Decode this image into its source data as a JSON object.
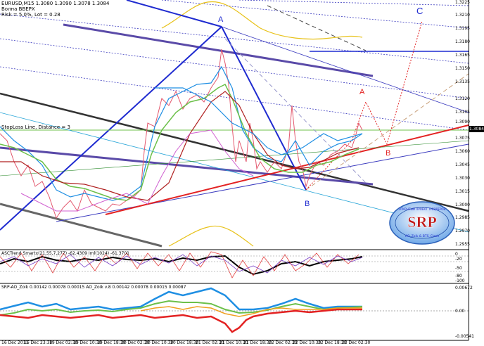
{
  "header": {
    "symbol_line": "EURUSD,M15  1.3080 1.3090 1.3078 1.3084",
    "indicator_name": "Волна BBEPX",
    "risk_line": "Risk = 5.0%, Lot = 0.28",
    "stoploss_label": "StopLoss Line, Distance = 3"
  },
  "price_axis": {
    "labels": [
      "1.3225",
      "1.3210",
      "1.3195",
      "1.3180",
      "1.3165",
      "1.3150",
      "1.3135",
      "1.3120",
      "1.3105",
      "1.3090",
      "1.3075",
      "1.3060",
      "1.3045",
      "1.3030",
      "1.3015",
      "1.3000",
      "1.2985",
      "1.2970",
      "1.2955"
    ],
    "last_price": "1.3084",
    "last_price_bg": "#000000"
  },
  "wave_labels": {
    "a_blue": "A",
    "b_blue": "B",
    "a_red": "A",
    "b_red": "B",
    "c_blue": "C",
    "blue_color": "#1f2bd0",
    "red_color": "#e32222"
  },
  "subwindow1": {
    "label": "ASCTrend Smartx(21,55,7,277) -62.4309  Iml(1024) -61.3701",
    "axis_labels": [
      "0",
      "-20",
      "-50",
      "-80",
      "-100"
    ]
  },
  "subwindow2": {
    "label": "SRP-AO_Zoik 0.00142 0.00078 0.00015  AO_Zoik v.8 0.00142 0.00078 0.00015 0.00087",
    "axis_labels": [
      "0.00672",
      "0.00",
      "-0.00541"
    ]
  },
  "time_axis": [
    "16 Dec 2011",
    "16 Dec 23:30",
    "19 Dec 02:30",
    "19 Dec 10:30",
    "19 Dec 18:30",
    "20 Dec 02:30",
    "20 Dec 10:30",
    "20 Dec 18:30",
    "21 Dec 02:30",
    "21 Dec 10:30",
    "21 Dec 18:30",
    "22 Dec 02:30",
    "22 Dec 10:30",
    "22 Dec 18:30",
    "23 Dec 02:30"
  ],
  "logo": {
    "text": "SRP",
    "ring_text": "ОТКРЫТЫЙ ПРОЕКТ ТРЕЙДЕРОВ",
    "sub_text": "AO_Zoik & BTS_Clash"
  }
}
